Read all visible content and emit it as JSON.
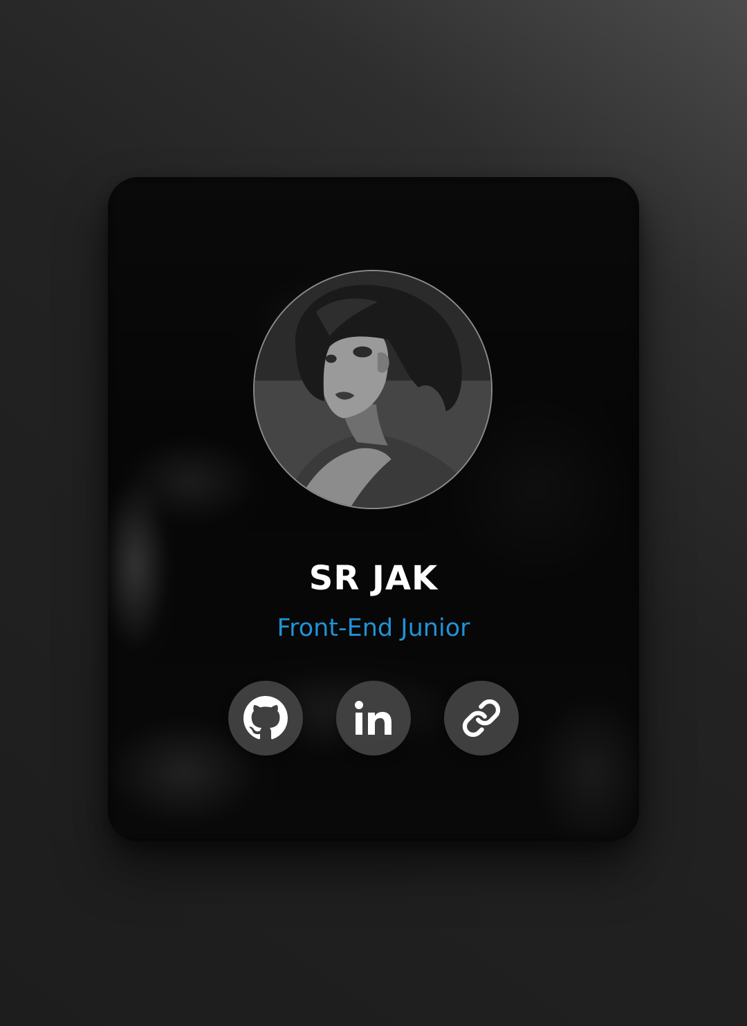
{
  "profile": {
    "name": "SR JAK",
    "role": "Front-End Junior",
    "avatar_icon": "avatar-portrait"
  },
  "socials": [
    {
      "icon": "github-icon",
      "label": "GitHub"
    },
    {
      "icon": "linkedin-icon",
      "label": "LinkedIn"
    },
    {
      "icon": "link-icon",
      "label": "Link"
    }
  ],
  "colors": {
    "name": "#ffffff",
    "role": "#1f93d6",
    "button_bg": "#444444",
    "card_bg": "#050505"
  }
}
